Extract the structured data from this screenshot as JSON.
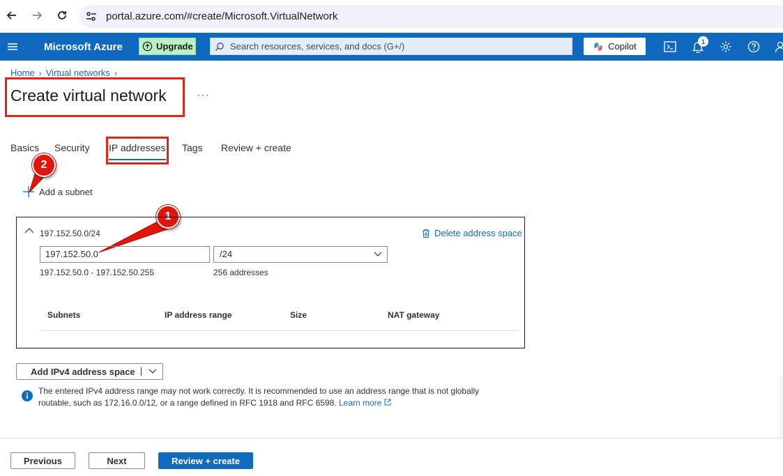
{
  "browser": {
    "url": "portal.azure.com/#create/Microsoft.VirtualNetwork"
  },
  "header": {
    "brand": "Microsoft Azure",
    "upgrade_label": "Upgrade",
    "search_placeholder": "Search resources, services, and docs (G+/)",
    "copilot_label": "Copilot",
    "notification_count": "1"
  },
  "breadcrumb": {
    "items": [
      "Home",
      "Virtual networks"
    ]
  },
  "page": {
    "title": "Create virtual network",
    "more": "···"
  },
  "tabs": [
    {
      "label": "Basics",
      "active": false
    },
    {
      "label": "Security",
      "active": false
    },
    {
      "label": "IP addresses",
      "active": true
    },
    {
      "label": "Tags",
      "active": false
    },
    {
      "label": "Review + create",
      "active": false
    }
  ],
  "add_subnet_label": "Add a subnet",
  "markers": [
    "1",
    "2"
  ],
  "address_space": {
    "cidr": "197.152.50.0/24",
    "delete_label": "Delete address space",
    "ip_value": "197.152.50.0",
    "mask_value": "/24",
    "range": "197.152.50.0 - 197.152.50.255",
    "count": "256 addresses",
    "columns": [
      "Subnets",
      "IP address range",
      "Size",
      "NAT gateway"
    ]
  },
  "add_ipv4_label": "Add IPv4 address space",
  "info": {
    "line1": "The entered IPv4 address range may not work correctly. It is recommended to use an address range that is not globally",
    "line2": "routable, such as 172.16.0.0/12, or a range defined in RFC 1918 and RFC 6598.",
    "learn_more": "Learn more"
  },
  "footer": {
    "previous": "Previous",
    "next": "Next",
    "review": "Review + create"
  },
  "colors": {
    "azure_blue": "#0f6cbd",
    "header_blue": "#1068bf",
    "annotation_red": "#e3241b"
  }
}
